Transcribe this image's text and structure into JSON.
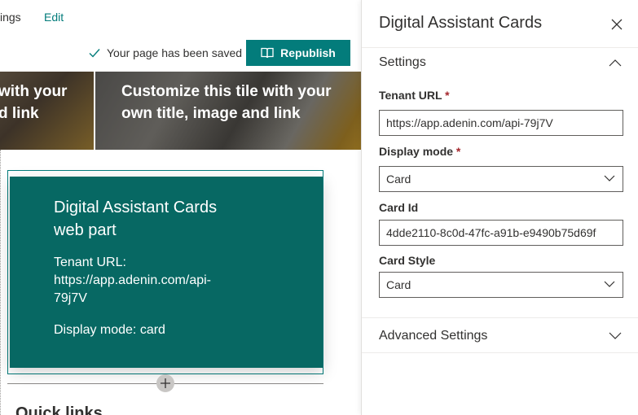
{
  "canvas": {
    "nav": {
      "settings_fragment": "ings",
      "edit": "Edit"
    },
    "status": {
      "saved_text": "Your page has been saved"
    },
    "republish_label": "Republish",
    "tiles": [
      {
        "text": "with your d link"
      },
      {
        "text": "Customize this tile with your own title, image and link"
      }
    ],
    "webpart": {
      "title": "Digital Assistant Cards web part",
      "tenant": "Tenant URL: https://app.adenin.com/api-79j7V",
      "mode": "Display mode: card",
      "bg_color": "#076863"
    },
    "next_section_title": "Quick links"
  },
  "panel": {
    "title": "Digital Assistant Cards",
    "settings_group": "Settings",
    "fields": {
      "tenant_url": {
        "label": "Tenant URL",
        "required": "*",
        "value": "https://app.adenin.com/api-79j7V"
      },
      "display_mode": {
        "label": "Display mode",
        "required": "*",
        "value": "Card"
      },
      "card_id": {
        "label": "Card Id",
        "value": "4dde2110-8c0d-47fc-a91b-e9490b75d69f"
      },
      "card_style": {
        "label": "Card Style",
        "value": "Card"
      }
    },
    "advanced_group": "Advanced Settings"
  },
  "colors": {
    "accent": "#037c7b",
    "required": "#a4262c"
  }
}
